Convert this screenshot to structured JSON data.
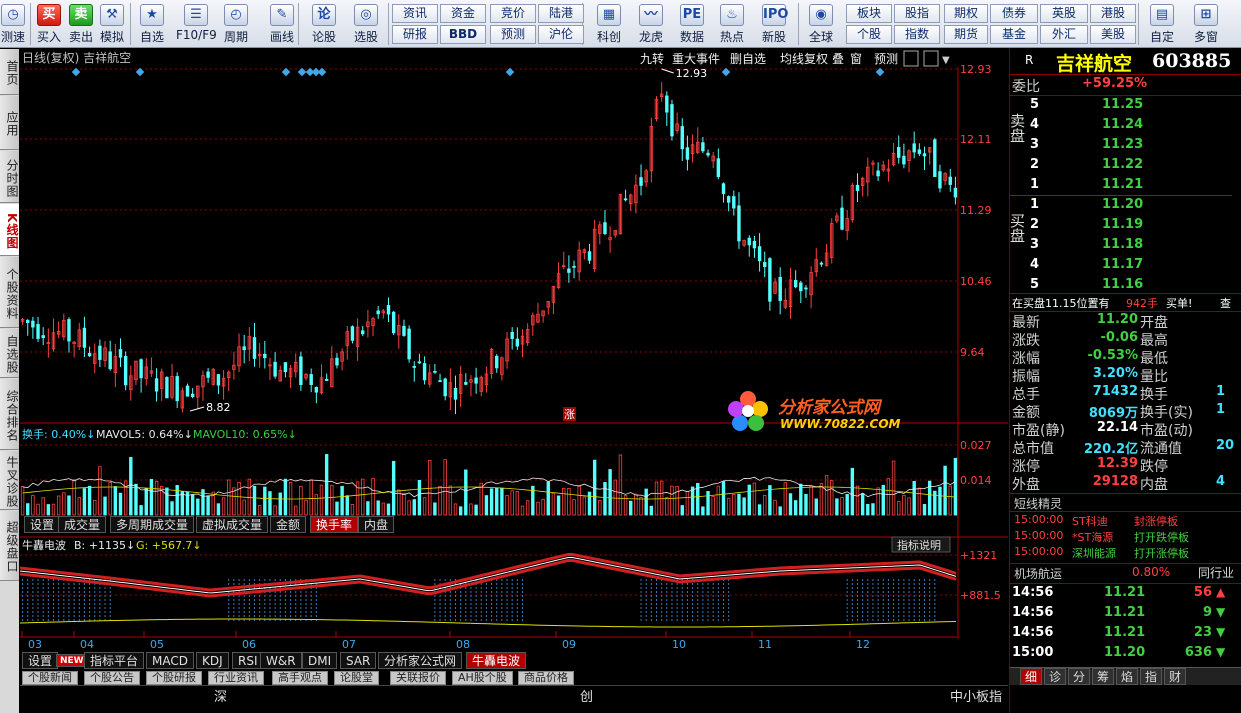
{
  "toolbar": {
    "buttons": [
      {
        "label": "测速",
        "icon": "clock-icon"
      },
      {
        "label": "买入",
        "icon": "buy-icon",
        "glyph": "买"
      },
      {
        "label": "卖出",
        "icon": "sell-icon",
        "glyph": "卖"
      },
      {
        "label": "模拟",
        "icon": "hammer-icon"
      },
      {
        "label": "自选",
        "icon": "star-icon"
      },
      {
        "label": "F10/F9",
        "icon": "list-icon"
      },
      {
        "label": "周期",
        "icon": "clock-period-icon"
      },
      {
        "label": "画线",
        "icon": "pen-icon"
      },
      {
        "label": "论股",
        "icon": "discuss-icon",
        "glyph": "论"
      },
      {
        "label": "选股",
        "icon": "select-icon"
      },
      {
        "label": "科创",
        "icon": "star-market-icon"
      },
      {
        "label": "龙虎",
        "icon": "dragon-icon"
      },
      {
        "label": "数据",
        "icon": "pe-icon",
        "glyph": "PE"
      },
      {
        "label": "热点",
        "icon": "hot-icon"
      },
      {
        "label": "新股",
        "icon": "ipo-icon",
        "glyph": "IPO"
      },
      {
        "label": "全球",
        "icon": "globe-icon"
      },
      {
        "label": "自定",
        "icon": "custom-icon"
      },
      {
        "label": "多窗",
        "icon": "multi-window-icon"
      }
    ],
    "quick_row1": [
      "资讯",
      "资金",
      "竞价",
      "陆港",
      "板块",
      "股指",
      "期权",
      "债券",
      "英股",
      "港股"
    ],
    "quick_row2": [
      "研报",
      "BBD",
      "预测",
      "沪伦",
      "个股",
      "指数",
      "期货",
      "基金",
      "外汇",
      "美股"
    ]
  },
  "left_tabs": [
    "首页",
    "应用",
    "分时图",
    "K线图",
    "个股资料",
    "自选股",
    "综合排名",
    "牛叉诊股",
    "超级盘口"
  ],
  "chart": {
    "header_left": "日线(复权) 吉祥航空",
    "header_buttons": [
      "九转",
      "重大事件",
      "删自选",
      "均线",
      "复权",
      "叠",
      "窗",
      "预测"
    ],
    "price_labels": [
      "12.93",
      "12.11",
      "11.29",
      "10.46",
      "9.64"
    ],
    "high_label": "12.93",
    "low_label": "8.82",
    "zhang_label": "涨",
    "vol_header": {
      "a": "换手: 0.40%↓",
      "b": "MAVOL5: 0.64%↓",
      "c": "MAVOL10: 0.65%↓"
    },
    "vol_labels": [
      "0.027",
      "0.014"
    ],
    "vol_tabs": [
      "设置",
      "成交量",
      "多周期成交量",
      "虚拟成交量",
      "金额",
      "换手率",
      "内盘"
    ],
    "ind_header": {
      "a": "牛轟电波",
      "b": "B: +1135↓",
      "c": "G: +567.7↓"
    },
    "ind_button": "指标说明",
    "ind_labels": [
      "+1321",
      "+881.5"
    ],
    "months": [
      "03",
      "04",
      "05",
      "06",
      "07",
      "08",
      "09",
      "10",
      "11",
      "12"
    ],
    "ind_tabs": [
      "设置",
      "NEW",
      "指标平台",
      "MACD",
      "KDJ",
      "RSI",
      "W&R",
      "DMI",
      "SAR",
      "分析家公式网",
      "牛轟电波"
    ],
    "news_tabs": [
      "个股新闻",
      "个股公告",
      "个股研报",
      "行业资讯",
      "高手观点",
      "论股堂",
      "关联报价",
      "AH股个股",
      "商品价格"
    ],
    "status": [
      "深",
      "创",
      "中小板指"
    ]
  },
  "watermark": {
    "title": "分析家公式网",
    "url": "WWW.70822.COM"
  },
  "quote": {
    "r": "R",
    "name": "吉祥航空",
    "code": "603885",
    "weibi_label": "委比",
    "weibi": "+59.25%",
    "sell_label": "卖盘",
    "buy_label": "买盘",
    "asks": [
      {
        "n": "5",
        "p": "11.25"
      },
      {
        "n": "4",
        "p": "11.24"
      },
      {
        "n": "3",
        "p": "11.23"
      },
      {
        "n": "2",
        "p": "11.22"
      },
      {
        "n": "1",
        "p": "11.21"
      }
    ],
    "bids": [
      {
        "n": "1",
        "p": "11.20"
      },
      {
        "n": "2",
        "p": "11.19"
      },
      {
        "n": "3",
        "p": "11.18"
      },
      {
        "n": "4",
        "p": "11.17"
      },
      {
        "n": "5",
        "p": "11.16"
      }
    ],
    "notice": {
      "a": "在买盘11.15位置有",
      "b": "942手",
      "c": "买单!",
      "d": "查"
    },
    "stats": [
      {
        "l": "最新",
        "v": "11.20",
        "c": "dn",
        "l2": "开盘"
      },
      {
        "l": "涨跌",
        "v": "-0.06",
        "c": "dn",
        "l2": "最高"
      },
      {
        "l": "涨幅",
        "v": "-0.53%",
        "c": "dn",
        "l2": "最低"
      },
      {
        "l": "振幅",
        "v": "3.20%",
        "c": "cya",
        "l2": "量比"
      },
      {
        "l": "总手",
        "v": "71432",
        "c": "cya",
        "l2": "换手",
        "v2": "1"
      },
      {
        "l": "金额",
        "v": "8069万",
        "c": "cya",
        "l2": "换手(实)",
        "v2": "1"
      },
      {
        "l": "市盈(静)",
        "v": "22.14",
        "c": "wht",
        "l2": "市盈(动)"
      },
      {
        "l": "总市值",
        "v": "220.2亿",
        "c": "cya",
        "l2": "流通值",
        "v2": "20"
      },
      {
        "l": "涨停",
        "v": "12.39",
        "c": "up",
        "l2": "跌停"
      },
      {
        "l": "外盘",
        "v": "29128",
        "c": "up",
        "l2": "内盘",
        "v2": "4"
      }
    ],
    "elf_title": "短线精灵",
    "elf": [
      {
        "t": "15:00:00",
        "s": "ST科迪",
        "e": "封涨停板"
      },
      {
        "t": "15:00:00",
        "s": "*ST海源",
        "e": "打开跌停板"
      },
      {
        "t": "15:00:00",
        "s": "深圳能源",
        "e": "打开涨停板"
      }
    ],
    "industry": {
      "name": "机场航运",
      "pct": "0.80%",
      "btn": "同行业"
    },
    "ticks": [
      {
        "t": "14:56",
        "p": "11.21",
        "v": "56",
        "d": "up"
      },
      {
        "t": "14:56",
        "p": "11.21",
        "v": "9",
        "d": "dn"
      },
      {
        "t": "14:56",
        "p": "11.21",
        "v": "23",
        "d": "dn"
      },
      {
        "t": "15:00",
        "p": "11.20",
        "v": "636",
        "d": "dn"
      }
    ],
    "bottom_tabs": [
      "细",
      "诊",
      "分",
      "筹",
      "焰",
      "指",
      "财"
    ]
  },
  "colors": {
    "up": "#ff4040",
    "down": "#54ffff",
    "grid": "#8b0000",
    "accent": "#c00000"
  }
}
